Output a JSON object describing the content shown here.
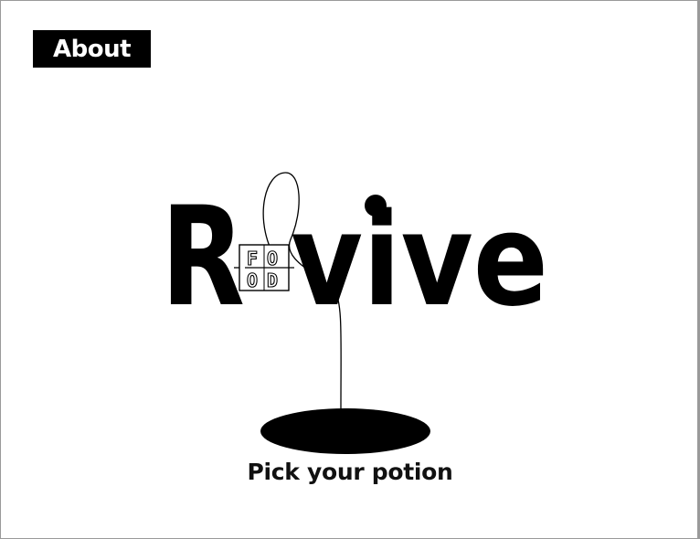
{
  "nav": {
    "about_label": "About"
  },
  "logo": {
    "letter_r": "R",
    "letters_vive": "vive",
    "food_top": "FO",
    "food_bottom": "OD",
    "food_top_left": "F",
    "food_top_right": "O",
    "food_bottom_left": "O",
    "food_bottom_right": "D"
  },
  "tagline": "Pick your potion"
}
